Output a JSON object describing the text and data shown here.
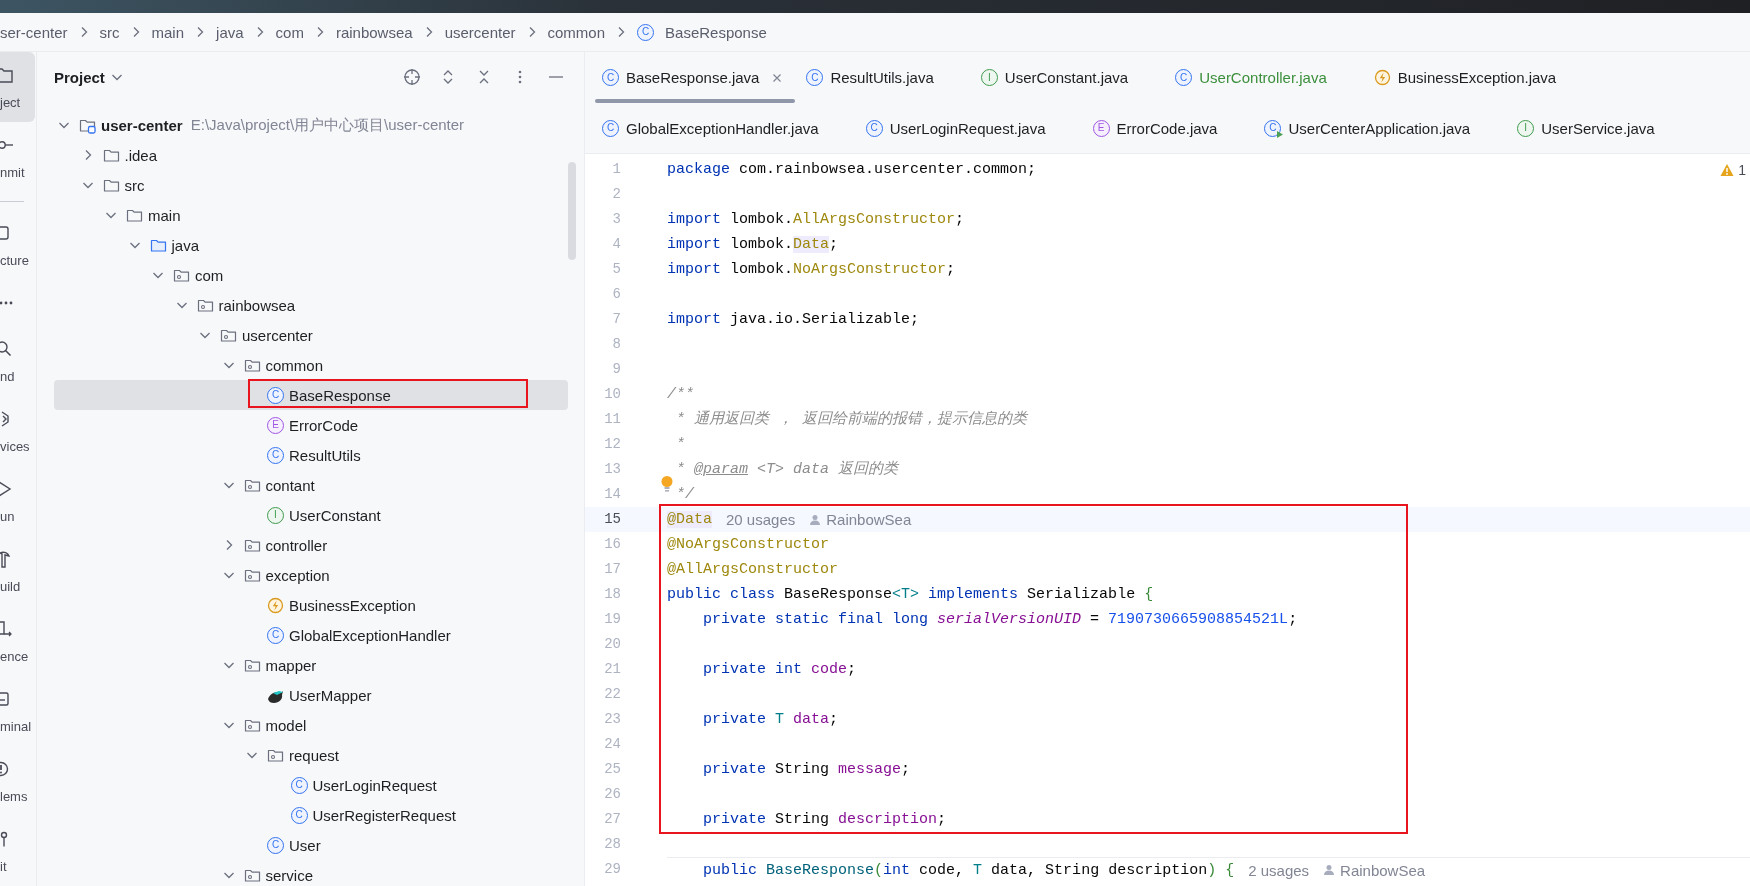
{
  "breadcrumbs": [
    {
      "label": "ser-center",
      "kind": "folder"
    },
    {
      "label": "src",
      "kind": "folder"
    },
    {
      "label": "main",
      "kind": "folder"
    },
    {
      "label": "java",
      "kind": "folder"
    },
    {
      "label": "com",
      "kind": "folder"
    },
    {
      "label": "rainbowsea",
      "kind": "folder"
    },
    {
      "label": "usercenter",
      "kind": "folder"
    },
    {
      "label": "common",
      "kind": "folder"
    },
    {
      "label": "BaseResponse",
      "kind": "class",
      "icon_text": "C"
    }
  ],
  "tool_strip": [
    {
      "kind": "project",
      "label": "ject",
      "selected": true
    },
    {
      "kind": "commit",
      "label": "nmit",
      "selected": false
    },
    {
      "kind": "divider"
    },
    {
      "kind": "structure",
      "label": "cture",
      "selected": false
    },
    {
      "kind": "more"
    },
    {
      "kind": "find",
      "label": "nd",
      "selected": false
    },
    {
      "kind": "services",
      "label": "vices",
      "selected": false
    },
    {
      "kind": "run",
      "label": "un",
      "selected": false
    },
    {
      "kind": "build",
      "label": "uild",
      "selected": false
    },
    {
      "kind": "dependence",
      "label": "ence",
      "selected": false
    },
    {
      "kind": "terminal",
      "label": "minal",
      "selected": false
    },
    {
      "kind": "problems",
      "label": "lems",
      "selected": false
    },
    {
      "kind": "git",
      "label": "it",
      "selected": false
    }
  ],
  "project_panel": {
    "title": "Project",
    "tree": [
      {
        "label": "user-center",
        "path": "E:\\Java\\project\\用户中心项目\\user-center",
        "kind": "module",
        "expanded": true,
        "selected": false,
        "children": [
          {
            "label": ".idea",
            "kind": "folder",
            "expanded": false,
            "selected": false
          },
          {
            "label": "src",
            "kind": "folder",
            "expanded": true,
            "selected": false,
            "children": [
              {
                "label": "main",
                "kind": "folder",
                "expanded": true,
                "selected": false,
                "children": [
                  {
                    "label": "java",
                    "kind": "source-folder",
                    "expanded": true,
                    "selected": false,
                    "children": [
                      {
                        "label": "com",
                        "kind": "package",
                        "expanded": true,
                        "selected": false,
                        "children": [
                          {
                            "label": "rainbowsea",
                            "kind": "package",
                            "expanded": true,
                            "selected": false,
                            "children": [
                              {
                                "label": "usercenter",
                                "kind": "package",
                                "expanded": true,
                                "selected": false,
                                "children": [
                                  {
                                    "label": "common",
                                    "kind": "package",
                                    "expanded": true,
                                    "selected": false,
                                    "children": [
                                      {
                                        "label": "BaseResponse",
                                        "kind": "class",
                                        "icon_text": "C",
                                        "selected": true,
                                        "marked": true
                                      },
                                      {
                                        "label": "ErrorCode",
                                        "kind": "enum",
                                        "icon_text": "E",
                                        "selected": false
                                      },
                                      {
                                        "label": "ResultUtils",
                                        "kind": "class",
                                        "icon_text": "C",
                                        "selected": false
                                      }
                                    ]
                                  },
                                  {
                                    "label": "contant",
                                    "kind": "package",
                                    "expanded": true,
                                    "selected": false,
                                    "children": [
                                      {
                                        "label": "UserConstant",
                                        "kind": "interface",
                                        "icon_text": "I",
                                        "selected": false
                                      }
                                    ]
                                  },
                                  {
                                    "label": "controller",
                                    "kind": "package",
                                    "expanded": false,
                                    "selected": false
                                  },
                                  {
                                    "label": "exception",
                                    "kind": "package",
                                    "expanded": true,
                                    "selected": false,
                                    "children": [
                                      {
                                        "label": "BusinessException",
                                        "kind": "exception",
                                        "selected": false
                                      },
                                      {
                                        "label": "GlobalExceptionHandler",
                                        "kind": "class",
                                        "icon_text": "C",
                                        "selected": false
                                      }
                                    ]
                                  },
                                  {
                                    "label": "mapper",
                                    "kind": "package",
                                    "expanded": true,
                                    "selected": false,
                                    "children": [
                                      {
                                        "label": "UserMapper",
                                        "kind": "mapper",
                                        "selected": false
                                      }
                                    ]
                                  },
                                  {
                                    "label": "model",
                                    "kind": "package",
                                    "expanded": true,
                                    "selected": false,
                                    "children": [
                                      {
                                        "label": "request",
                                        "kind": "package",
                                        "expanded": true,
                                        "selected": false,
                                        "children": [
                                          {
                                            "label": "UserLoginRequest",
                                            "kind": "class",
                                            "icon_text": "C",
                                            "selected": false
                                          },
                                          {
                                            "label": "UserRegisterRequest",
                                            "kind": "class",
                                            "icon_text": "C",
                                            "selected": false
                                          }
                                        ]
                                      },
                                      {
                                        "label": "User",
                                        "kind": "class",
                                        "icon_text": "C",
                                        "selected": false
                                      }
                                    ]
                                  },
                                  {
                                    "label": "service",
                                    "kind": "package",
                                    "expanded": true,
                                    "selected": false
                                  }
                                ]
                              }
                            ]
                          }
                        ]
                      }
                    ]
                  }
                ]
              }
            ]
          }
        ]
      }
    ]
  },
  "editor": {
    "tab_rows": [
      [
        {
          "label": "BaseResponse.java",
          "kind": "class",
          "icon_text": "C",
          "selected": true,
          "added": false
        },
        {
          "label": "ResultUtils.java",
          "kind": "class",
          "icon_text": "C",
          "selected": false,
          "added": false
        },
        {
          "label": "UserConstant.java",
          "kind": "interface",
          "icon_text": "I",
          "selected": false,
          "added": false
        },
        {
          "label": "UserController.java",
          "kind": "class",
          "icon_text": "C",
          "selected": false,
          "added": true
        },
        {
          "label": "BusinessException.java",
          "kind": "exception",
          "selected": false,
          "added": false
        }
      ],
      [
        {
          "label": "GlobalExceptionHandler.java",
          "kind": "class",
          "icon_text": "C",
          "selected": false,
          "added": false
        },
        {
          "label": "UserLoginRequest.java",
          "kind": "class",
          "icon_text": "C",
          "selected": false,
          "added": false
        },
        {
          "label": "ErrorCode.java",
          "kind": "enum",
          "icon_text": "E",
          "selected": false,
          "added": false
        },
        {
          "label": "UserCenterApplication.java",
          "kind": "app",
          "icon_text": "C",
          "selected": false,
          "added": false
        },
        {
          "label": "UserService.java",
          "kind": "interface",
          "icon_text": "I",
          "selected": false,
          "added": false
        }
      ]
    ],
    "warnings": "1",
    "lines": [
      {
        "kind": "line",
        "number": "1",
        "tokens": [
          {
            "kind": "kw",
            "text": "package"
          },
          {
            "kind": "plain",
            "text": " com.rainbowsea.usercenter.common;"
          }
        ]
      },
      {
        "kind": "line",
        "number": "2"
      },
      {
        "kind": "line",
        "number": "3",
        "tokens": [
          {
            "kind": "kw",
            "text": "import"
          },
          {
            "kind": "plain",
            "text": " lombok."
          },
          {
            "kind": "annotation",
            "text": "AllArgsConstructor"
          },
          {
            "kind": "plain",
            "text": ";"
          }
        ]
      },
      {
        "kind": "line",
        "number": "4",
        "tokens": [
          {
            "kind": "kw",
            "text": "import"
          },
          {
            "kind": "plain",
            "text": " lombok."
          },
          {
            "kind": "annotation-hl",
            "text": "Data"
          },
          {
            "kind": "plain",
            "text": ";"
          }
        ]
      },
      {
        "kind": "line",
        "number": "5",
        "tokens": [
          {
            "kind": "kw",
            "text": "import"
          },
          {
            "kind": "plain",
            "text": " lombok."
          },
          {
            "kind": "annotation",
            "text": "NoArgsConstructor"
          },
          {
            "kind": "plain",
            "text": ";"
          }
        ]
      },
      {
        "kind": "line",
        "number": "6"
      },
      {
        "kind": "line",
        "number": "7",
        "tokens": [
          {
            "kind": "kw",
            "text": "import"
          },
          {
            "kind": "plain",
            "text": " java.io.Serializable;"
          }
        ]
      },
      {
        "kind": "line",
        "number": "8"
      },
      {
        "kind": "line",
        "number": "9"
      },
      {
        "kind": "line",
        "number": "10",
        "tokens": [
          {
            "kind": "comment",
            "text": "/**"
          }
        ]
      },
      {
        "kind": "line",
        "number": "11",
        "tokens": [
          {
            "kind": "comment",
            "text": " * 通用返回类 ， 返回给前端的报错，提示信息的类"
          }
        ]
      },
      {
        "kind": "line",
        "number": "12",
        "tokens": [
          {
            "kind": "comment",
            "text": " *"
          }
        ]
      },
      {
        "kind": "line",
        "number": "13",
        "tokens": [
          {
            "kind": "comment",
            "text": " * "
          },
          {
            "kind": "doc-tag",
            "text": "@param"
          },
          {
            "kind": "comment",
            "text": " <T> data 返回的类"
          }
        ]
      },
      {
        "kind": "line",
        "number": "14",
        "bulb": true,
        "tokens": [
          {
            "kind": "comment",
            "text": " */"
          }
        ]
      },
      {
        "kind": "highlight-box",
        "lines": [
          {
            "kind": "line",
            "number": "15",
            "current": true,
            "tokens": [
              {
                "kind": "annotation-hl",
                "text": "@Data"
              }
            ],
            "hints": [
              {
                "kind": "usages",
                "text": "20 usages"
              },
              {
                "kind": "author",
                "text": "RainbowSea"
              }
            ]
          },
          {
            "kind": "line",
            "number": "16",
            "tokens": [
              {
                "kind": "annotation",
                "text": "@NoArgsConstructor"
              }
            ]
          },
          {
            "kind": "line",
            "number": "17",
            "tokens": [
              {
                "kind": "annotation",
                "text": "@AllArgsConstructor"
              }
            ]
          },
          {
            "kind": "line",
            "number": "18",
            "tokens": [
              {
                "kind": "kw",
                "text": "public class"
              },
              {
                "kind": "plain",
                "text": " BaseResponse"
              },
              {
                "kind": "type-param",
                "text": "<T>"
              },
              {
                "kind": "kw",
                "text": " implements"
              },
              {
                "kind": "plain",
                "text": " Serializable "
              },
              {
                "kind": "bracket",
                "text": "{"
              }
            ]
          },
          {
            "kind": "line",
            "number": "19",
            "tokens": [
              {
                "kind": "kw",
                "text": "    private static final long"
              },
              {
                "kind": "static-field",
                "text": " serialVersionUID"
              },
              {
                "kind": "plain",
                "text": " = "
              },
              {
                "kind": "number",
                "text": "7190730665908854521L"
              },
              {
                "kind": "plain",
                "text": ";"
              }
            ]
          },
          {
            "kind": "line",
            "number": "20"
          },
          {
            "kind": "line",
            "number": "21",
            "tokens": [
              {
                "kind": "kw",
                "text": "    private int"
              },
              {
                "kind": "field",
                "text": " code"
              },
              {
                "kind": "plain",
                "text": ";"
              }
            ]
          },
          {
            "kind": "line",
            "number": "22"
          },
          {
            "kind": "line",
            "number": "23",
            "tokens": [
              {
                "kind": "kw",
                "text": "    private"
              },
              {
                "kind": "type-param",
                "text": " T"
              },
              {
                "kind": "field",
                "text": " data"
              },
              {
                "kind": "plain",
                "text": ";"
              }
            ]
          },
          {
            "kind": "line",
            "number": "24"
          },
          {
            "kind": "line",
            "number": "25",
            "tokens": [
              {
                "kind": "kw",
                "text": "    private"
              },
              {
                "kind": "plain",
                "text": " String "
              },
              {
                "kind": "field",
                "text": "message"
              },
              {
                "kind": "plain",
                "text": ";"
              }
            ]
          },
          {
            "kind": "line",
            "number": "26"
          },
          {
            "kind": "line",
            "number": "27",
            "tokens": [
              {
                "kind": "kw",
                "text": "    private"
              },
              {
                "kind": "plain",
                "text": " String "
              },
              {
                "kind": "field",
                "text": "description"
              },
              {
                "kind": "plain",
                "text": ";"
              }
            ]
          }
        ]
      },
      {
        "kind": "line",
        "number": "28"
      },
      {
        "kind": "line",
        "number": "29",
        "separated": true,
        "tokens": [
          {
            "kind": "kw",
            "text": "    public"
          },
          {
            "kind": "method",
            "text": " BaseResponse"
          },
          {
            "kind": "bracket",
            "text": "("
          },
          {
            "kind": "kw",
            "text": "int"
          },
          {
            "kind": "plain",
            "text": " code, "
          },
          {
            "kind": "type-param",
            "text": "T"
          },
          {
            "kind": "plain",
            "text": " data, String description"
          },
          {
            "kind": "bracket",
            "text": ")"
          },
          {
            "kind": "bracket",
            "text": " {"
          }
        ],
        "hints": [
          {
            "kind": "usages",
            "text": "2 usages"
          },
          {
            "kind": "author",
            "text": "RainbowSea"
          }
        ]
      }
    ]
  }
}
